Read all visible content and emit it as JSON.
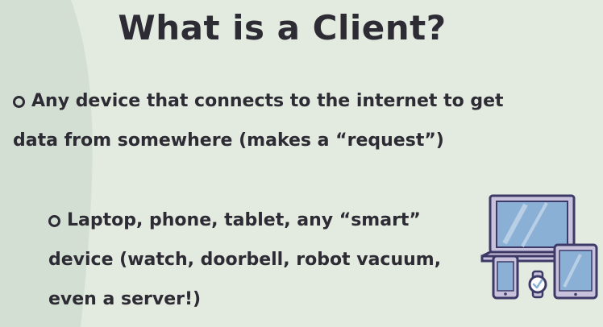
{
  "slide": {
    "title": "What is a Client?",
    "bullets": [
      {
        "text": "Any device that connects to the internet to get data from somewhere (makes a “request”)",
        "sub_bullets": [
          {
            "text": "Laptop, phone, tablet, any “smart” device (watch, doorbell, robot vacuum, even a server!)"
          }
        ]
      }
    ]
  },
  "illustration": {
    "icons": [
      "laptop-icon",
      "phone-icon",
      "smartwatch-icon",
      "tablet-icon"
    ],
    "colors": {
      "outline": "#3e3a68",
      "screen": "#8bb0d6",
      "body": "#c9c2dc",
      "background": "#e3eadf"
    }
  }
}
